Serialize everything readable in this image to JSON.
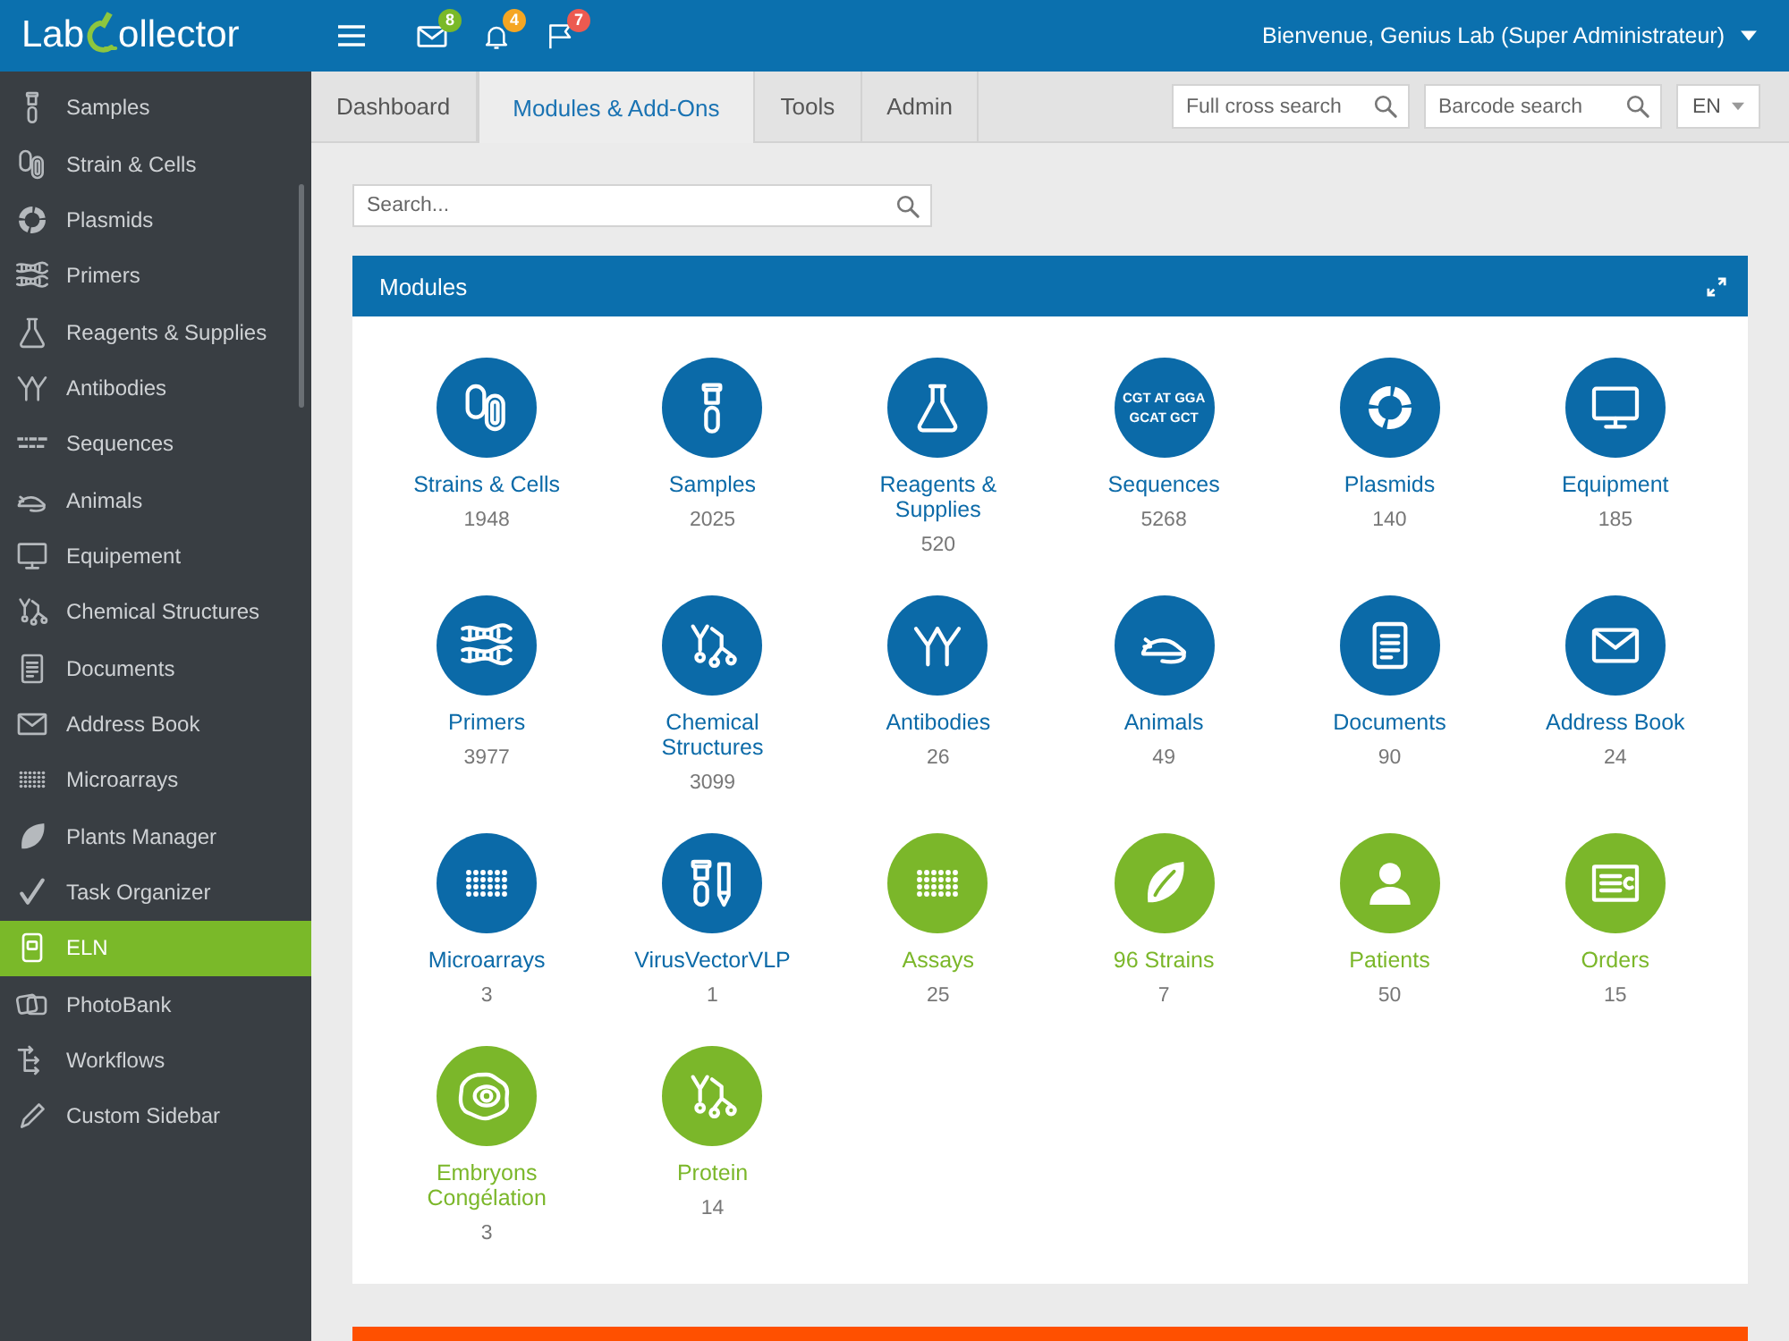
{
  "logo": {
    "prefix": "Lab",
    "suffix": "ollector"
  },
  "topbar": {
    "notifications": [
      {
        "count": "8",
        "color": "#7ab929"
      },
      {
        "count": "4",
        "color": "#f5a623"
      },
      {
        "count": "7",
        "color": "#ec5a50"
      }
    ],
    "user": "Bienvenue, Genius Lab (Super Administrateur)"
  },
  "sidebar": {
    "items": [
      {
        "label": "Samples",
        "selected": false
      },
      {
        "label": "Strain & Cells",
        "selected": false
      },
      {
        "label": "Plasmids",
        "selected": false
      },
      {
        "label": "Primers",
        "selected": false
      },
      {
        "label": "Reagents & Supplies",
        "selected": false
      },
      {
        "label": "Antibodies",
        "selected": false
      },
      {
        "label": "Sequences",
        "selected": false
      },
      {
        "label": "Animals",
        "selected": false
      },
      {
        "label": "Equipement",
        "selected": false
      },
      {
        "label": "Chemical Structures",
        "selected": false
      },
      {
        "label": "Documents",
        "selected": false
      },
      {
        "label": "Address Book",
        "selected": false
      },
      {
        "label": "Microarrays",
        "selected": false
      },
      {
        "label": "Plants Manager",
        "selected": false
      },
      {
        "label": "Task Organizer",
        "selected": false
      },
      {
        "label": "ELN",
        "selected": true
      },
      {
        "label": "PhotoBank",
        "selected": false
      },
      {
        "label": "Workflows",
        "selected": false
      },
      {
        "label": "Custom Sidebar",
        "selected": false
      }
    ]
  },
  "tabs": [
    {
      "label": "Dashboard",
      "selected": false
    },
    {
      "label": "Modules & Add-Ons",
      "selected": true
    },
    {
      "label": "Tools",
      "selected": false
    },
    {
      "label": "Admin",
      "selected": false
    }
  ],
  "cross_search": {
    "placeholder": "Full cross search"
  },
  "barcode_search": {
    "placeholder": "Barcode search"
  },
  "language": {
    "value": "EN"
  },
  "search": {
    "placeholder": "Search..."
  },
  "modules": {
    "title": "Modules",
    "items": [
      {
        "label": "Strains & Cells",
        "count": "1948",
        "color": "#0b6aa8"
      },
      {
        "label": "Samples",
        "count": "2025",
        "color": "#0b6aa8"
      },
      {
        "label": "Reagents & Supplies",
        "count": "520",
        "color": "#0b6aa8"
      },
      {
        "label": "Sequences",
        "count": "5268",
        "color": "#0b6aa8",
        "icon_text": [
          "CGT AT GGA",
          "GCAT GCT"
        ]
      },
      {
        "label": "Plasmids",
        "count": "140",
        "color": "#0b6aa8"
      },
      {
        "label": "Equipment",
        "count": "185",
        "color": "#0b6aa8"
      },
      {
        "label": "Primers",
        "count": "3977",
        "color": "#0b6aa8"
      },
      {
        "label": "Chemical Structures",
        "count": "3099",
        "color": "#0b6aa8"
      },
      {
        "label": "Antibodies",
        "count": "26",
        "color": "#0b6aa8"
      },
      {
        "label": "Animals",
        "count": "49",
        "color": "#0b6aa8"
      },
      {
        "label": "Documents",
        "count": "90",
        "color": "#0b6aa8"
      },
      {
        "label": "Address Book",
        "count": "24",
        "color": "#0b6aa8"
      },
      {
        "label": "Microarrays",
        "count": "3",
        "color": "#0b6aa8"
      },
      {
        "label": "VirusVectorVLP",
        "count": "1",
        "color": "#0b6aa8"
      },
      {
        "label": "Assays",
        "count": "25",
        "color": "#7bb72a"
      },
      {
        "label": "96 Strains",
        "count": "7",
        "color": "#7bb72a"
      },
      {
        "label": "Patients",
        "count": "50",
        "color": "#7bb72a"
      },
      {
        "label": "Orders",
        "count": "15",
        "color": "#7bb72a"
      },
      {
        "label": "Embryons Congélation",
        "count": "3",
        "color": "#7bb72a"
      },
      {
        "label": "Protein",
        "count": "14",
        "color": "#7bb72a"
      }
    ]
  }
}
